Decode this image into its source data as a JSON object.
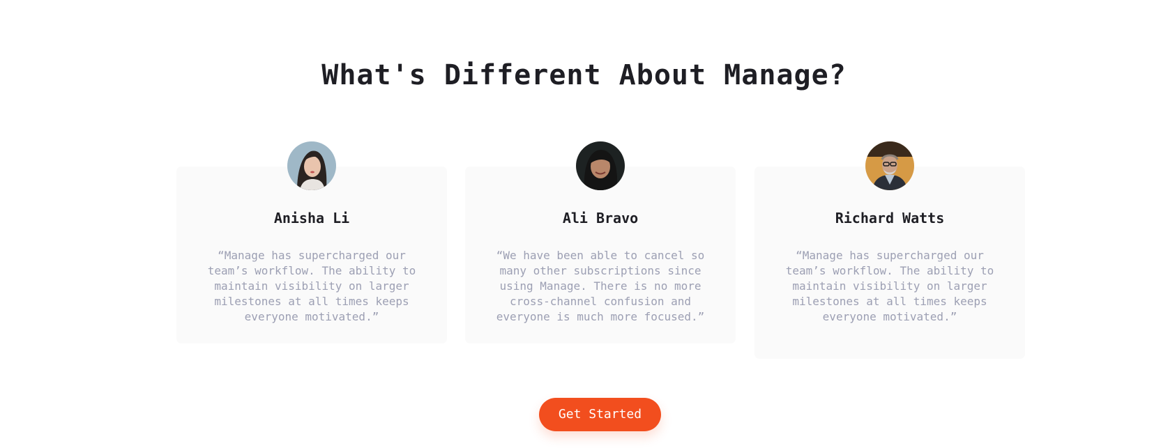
{
  "section": {
    "title": "What's Different About Manage?"
  },
  "testimonials": [
    {
      "name": "Anisha Li",
      "quote": "“Manage has supercharged our team’s workflow. The ability to maintain visibility on larger milestones at all times keeps everyone motivated.”",
      "avatar_icon": "avatar-woman-light-background"
    },
    {
      "name": "Ali Bravo",
      "quote": "“We have been able to cancel so many other subscriptions since using Manage. There is no more cross-channel confusion and everyone is much more focused.”",
      "avatar_icon": "avatar-woman-dark-background"
    },
    {
      "name": "Richard Watts",
      "quote": "“Manage has supercharged our team’s workflow. The ability to maintain visibility on larger milestones at all times keeps everyone motivated.”",
      "avatar_icon": "avatar-man-warm-background"
    }
  ],
  "cta": {
    "label": "Get Started"
  },
  "colors": {
    "accent": "#f24e1e",
    "heading": "#1e1e24",
    "body_text": "#9c9fb3",
    "card_bg": "#fafafa"
  }
}
